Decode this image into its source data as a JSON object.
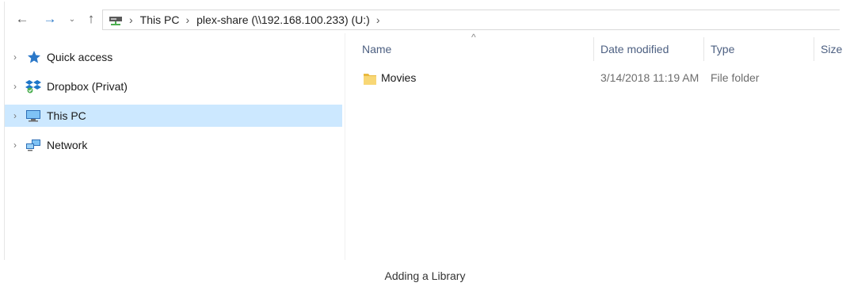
{
  "nav": {
    "back_icon": "←",
    "forward_icon": "→",
    "recent_icon": "⌄",
    "up_icon": "↑"
  },
  "address": {
    "crumbs": [
      "This PC",
      "plex-share (\\\\192.168.100.233) (U:)"
    ],
    "separator": "›"
  },
  "sidebar": {
    "items": [
      {
        "label": "Quick access"
      },
      {
        "label": "Dropbox (Privat)"
      },
      {
        "label": "This PC"
      },
      {
        "label": "Network"
      }
    ],
    "chevron": "›"
  },
  "columns": {
    "name": "Name",
    "date": "Date modified",
    "type": "Type",
    "size": "Size",
    "sort_indicator": "^"
  },
  "files": [
    {
      "name": "Movies",
      "date": "3/14/2018 11:19 AM",
      "type": "File folder"
    }
  ],
  "caption": "Adding a Library",
  "colors": {
    "selection": "#cce8ff",
    "accent": "#2b78c8",
    "folder": "#f8d775"
  }
}
